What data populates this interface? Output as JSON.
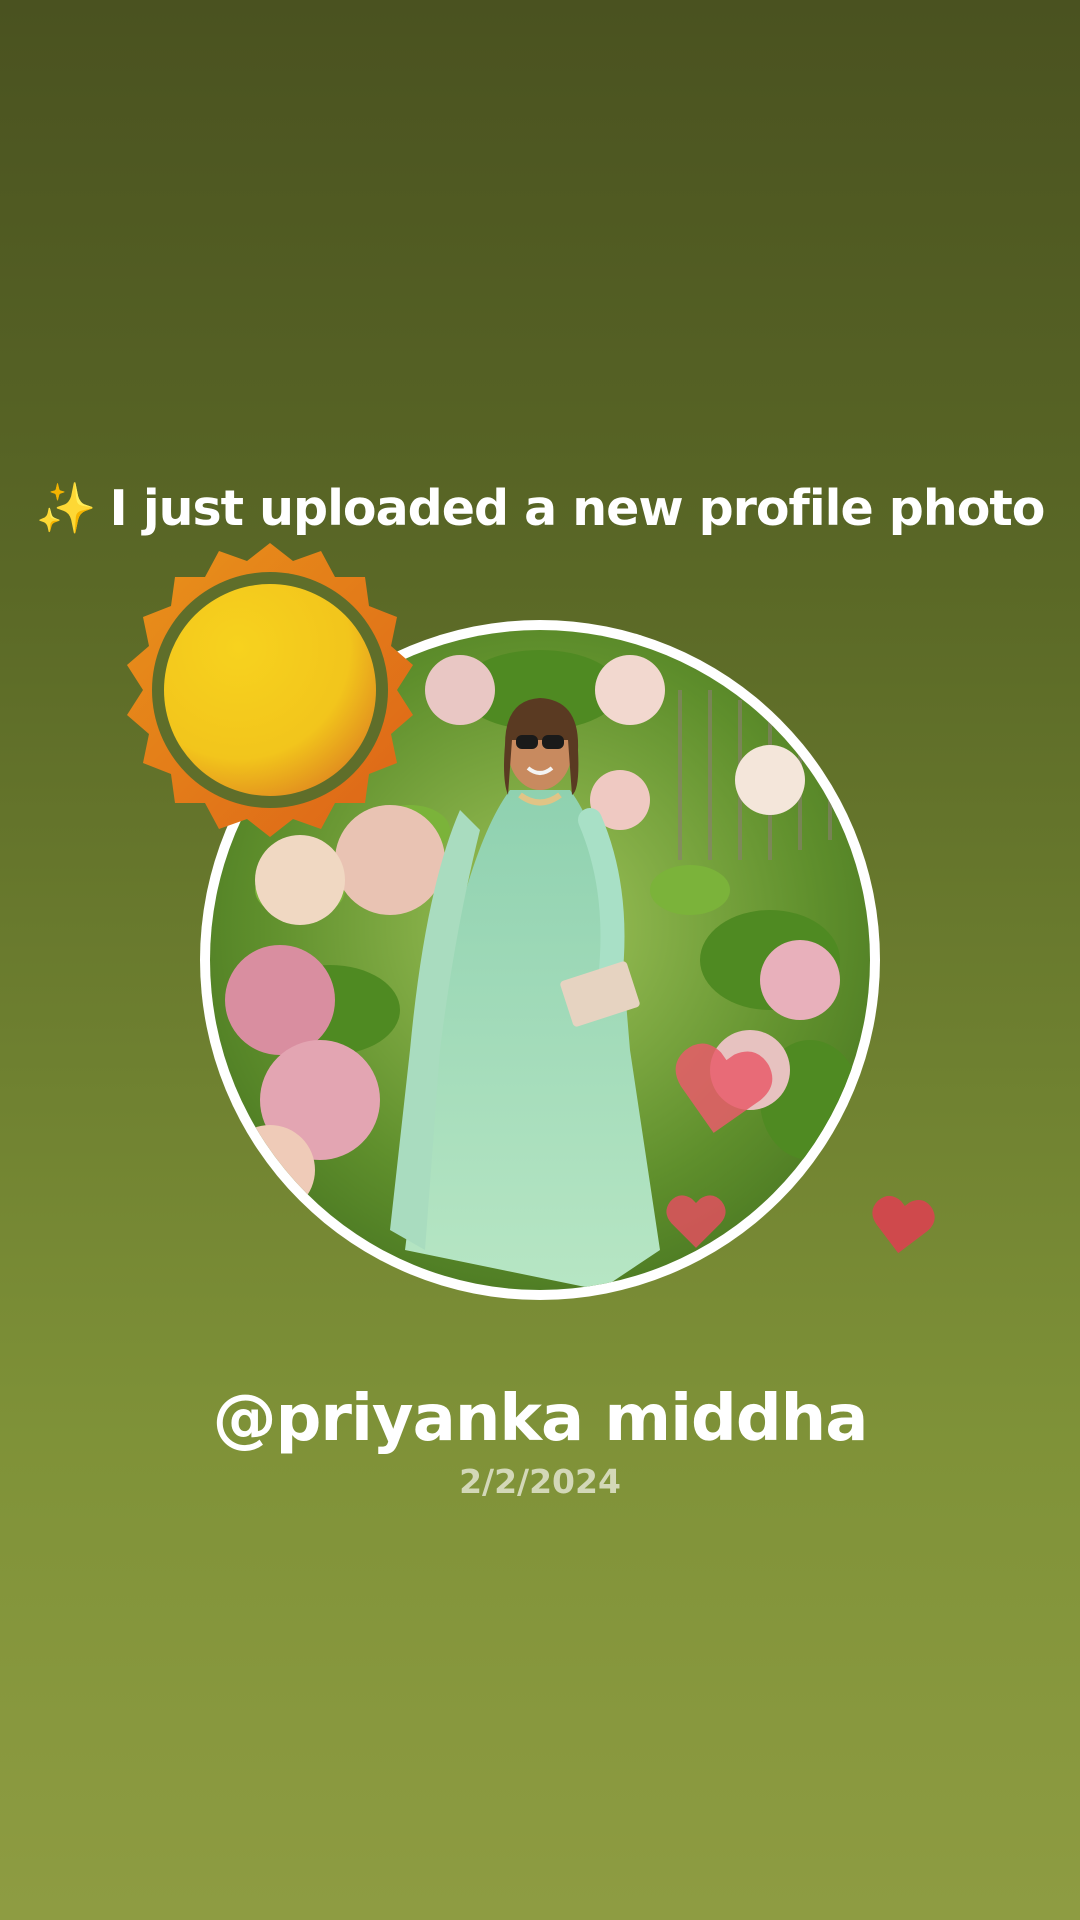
{
  "post": {
    "headline_icon": "✨",
    "headline": "I just uploaded a new profile photo",
    "username": "@priyanka middha",
    "date": "2/2/2024"
  },
  "decorations": {
    "sun_icon": "sun-icon",
    "heart_icon": "heart-icon"
  },
  "colors": {
    "background_top": "#4a5220",
    "background_bottom": "#8e9c42",
    "text": "#ffffff",
    "date_text": "#d3d8b8",
    "sun_inner": "#f2c51c",
    "sun_outer": "#e07418",
    "heart": "#e04a55",
    "frame": "#ffffff"
  }
}
